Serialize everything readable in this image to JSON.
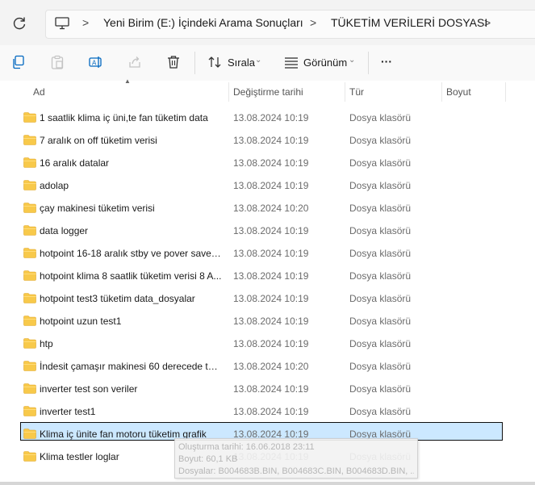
{
  "address": {
    "crumbs": [
      "Yeni Birim (E:) İçindeki Arama Sonuçları",
      "TÜKETİM VERİLERİ DOSYASI"
    ],
    "separator": ">"
  },
  "toolbar": {
    "sort_label": "Sırala",
    "view_label": "Görünüm",
    "more_label": "···"
  },
  "columns": {
    "name": "Ad",
    "date": "Değiştirme tarihi",
    "type": "Tür",
    "size": "Boyut"
  },
  "rows": [
    {
      "name": "1 saatlik klima iç üni,te fan tüketim data",
      "date": "13.08.2024 10:19",
      "type": "Dosya klasörü"
    },
    {
      "name": "7 aralık on off tüketim verisi",
      "date": "13.08.2024 10:19",
      "type": "Dosya klasörü"
    },
    {
      "name": "16 aralık datalar",
      "date": "13.08.2024 10:19",
      "type": "Dosya klasörü"
    },
    {
      "name": "adolap",
      "date": "13.08.2024 10:19",
      "type": "Dosya klasörü"
    },
    {
      "name": "çay makinesi tüketim verisi",
      "date": "13.08.2024 10:20",
      "type": "Dosya klasörü"
    },
    {
      "name": "data logger",
      "date": "13.08.2024 10:19",
      "type": "Dosya klasörü"
    },
    {
      "name": "hotpoint 16-18 aralık stby ve pover save t...",
      "date": "13.08.2024 10:19",
      "type": "Dosya klasörü"
    },
    {
      "name": "hotpoint klima 8 saatlik tüketim verisi 8 A...",
      "date": "13.08.2024 10:19",
      "type": "Dosya klasörü"
    },
    {
      "name": "hotpoint test3 tüketim data_dosyalar",
      "date": "13.08.2024 10:19",
      "type": "Dosya klasörü"
    },
    {
      "name": "hotpoint uzun test1",
      "date": "13.08.2024 10:19",
      "type": "Dosya klasörü"
    },
    {
      "name": "htp",
      "date": "13.08.2024 10:19",
      "type": "Dosya klasörü"
    },
    {
      "name": "İndesit çamaşır makinesi 60 derecede tük...",
      "date": "13.08.2024 10:20",
      "type": "Dosya klasörü"
    },
    {
      "name": "inverter test son veriler",
      "date": "13.08.2024 10:19",
      "type": "Dosya klasörü"
    },
    {
      "name": "inverter test1",
      "date": "13.08.2024 10:19",
      "type": "Dosya klasörü"
    },
    {
      "name": "Klima iç ünite fan motoru tüketim grafik",
      "date": "13.08.2024 10:19",
      "type": "Dosya klasörü",
      "selected": true
    },
    {
      "name": "Klima testler loglar",
      "date": "13.08.2024 10:19",
      "type": "Dosya klasörü"
    }
  ],
  "tooltip": {
    "line1": "Oluşturma tarihi: 16.06.2018 23:11",
    "line2": "Boyut: 60,1 KB",
    "line3": "Dosyalar: B004683B.BIN, B004683C.BIN, B004683D.BIN, ..."
  },
  "colors": {
    "folder": "#f8c94a",
    "selected_bg": "#cce8ff",
    "accent": "#0067c0"
  }
}
